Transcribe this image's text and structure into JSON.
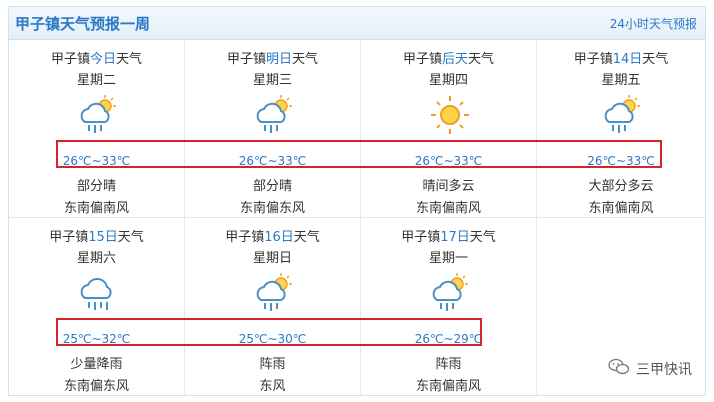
{
  "header": {
    "title": "甲子镇天气预报一周",
    "link_24h": "24小时天气预报"
  },
  "days": [
    {
      "prefix": "甲子镇",
      "day": "今日",
      "suffix": "天气",
      "weekday": "星期二",
      "icon": "partly-cloudy-rain-icon",
      "temp": "26℃~33℃",
      "desc": "部分晴",
      "wind": "东南偏南风"
    },
    {
      "prefix": "甲子镇",
      "day": "明日",
      "suffix": "天气",
      "weekday": "星期三",
      "icon": "partly-cloudy-rain-icon",
      "temp": "26℃~33℃",
      "desc": "部分晴",
      "wind": "东南偏东风"
    },
    {
      "prefix": "甲子镇",
      "day": "后天",
      "suffix": "天气",
      "weekday": "星期四",
      "icon": "sun-icon",
      "temp": "26℃~33℃",
      "desc": "晴间多云",
      "wind": "东南偏南风"
    },
    {
      "prefix": "甲子镇",
      "day": "14日",
      "suffix": "天气",
      "weekday": "星期五",
      "icon": "partly-cloudy-rain-icon",
      "temp": "26℃~33℃",
      "desc": "大部分多云",
      "wind": "东南偏南风"
    },
    {
      "prefix": "甲子镇",
      "day": "15日",
      "suffix": "天气",
      "weekday": "星期六",
      "icon": "rain-cloud-icon",
      "temp": "25℃~32℃",
      "desc": "少量降雨",
      "wind": "东南偏东风"
    },
    {
      "prefix": "甲子镇",
      "day": "16日",
      "suffix": "天气",
      "weekday": "星期日",
      "icon": "partly-cloudy-rain-icon",
      "temp": "25℃~30℃",
      "desc": "阵雨",
      "wind": "东风"
    },
    {
      "prefix": "甲子镇",
      "day": "17日",
      "suffix": "天气",
      "weekday": "星期一",
      "icon": "partly-cloudy-rain-icon",
      "temp": "26℃~29℃",
      "desc": "阵雨",
      "wind": "东南偏南风"
    }
  ],
  "watermark": {
    "text": "三甲快讯",
    "icon": "wechat-icon"
  },
  "colors": {
    "accent": "#2b78c5",
    "highlight_border": "#d8232a"
  }
}
